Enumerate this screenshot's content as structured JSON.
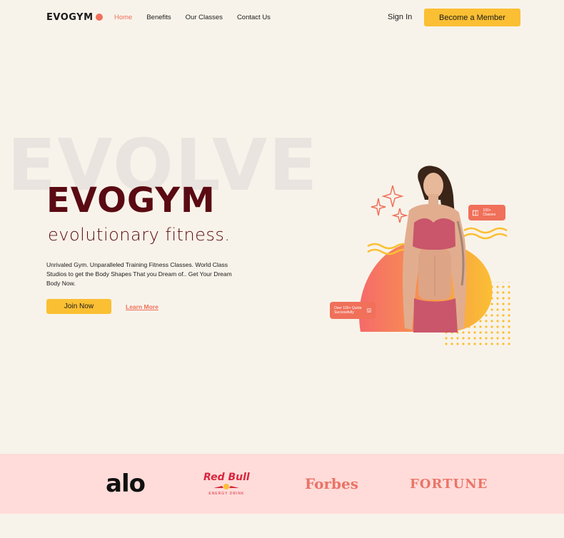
{
  "nav": {
    "logo": "EVOGYM",
    "links": [
      {
        "label": "Home",
        "active": true
      },
      {
        "label": "Benefits",
        "active": false
      },
      {
        "label": "Our Classes",
        "active": false
      },
      {
        "label": "Contact Us",
        "active": false
      }
    ],
    "sign_in": "Sign In",
    "cta": "Become a Member"
  },
  "hero": {
    "background_word": "EVOLVE",
    "title": "EVOGYM",
    "subtitle": "evolutionary fitness.",
    "description": "Unrivaled Gym. Unparalleled Training Fitness Classes. World Class Studios to get the Body Shapes That you Dream of.. Get Your Dream Body Now.",
    "join_label": "Join Now",
    "learn_label": "Learn More",
    "badges": {
      "classes": "100+ Classes",
      "quotes": "Over 100+ Quote Successfully"
    }
  },
  "brands": {
    "alo": "alo",
    "redbull": "Red Bull",
    "redbull_sub": "ENERGY DRINK",
    "forbes": "Forbes",
    "fortune": "FORTUNE"
  },
  "colors": {
    "background": "#f8f3ea",
    "accent": "#f0705a",
    "primary_dark": "#5a0a12",
    "button": "#fbbf33",
    "brand_band": "#ffdcd9"
  }
}
